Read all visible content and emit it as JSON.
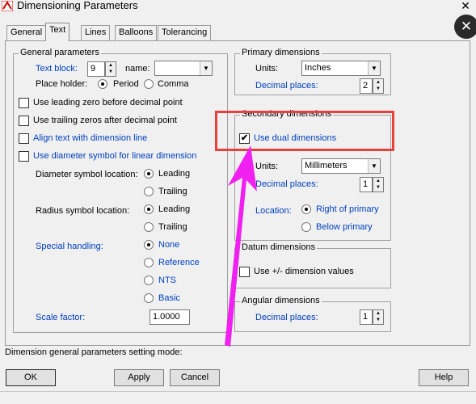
{
  "window": {
    "title": "Dimensioning Parameters",
    "close_glyph": "✕"
  },
  "overlay": {
    "close_glyph": "✕"
  },
  "tabs": [
    {
      "label": "General"
    },
    {
      "label": "Text"
    },
    {
      "label": "Lines"
    },
    {
      "label": "Balloons"
    },
    {
      "label": "Tolerancing"
    }
  ],
  "general_parameters": {
    "title": "General parameters",
    "text_block_label": "Text block:",
    "text_block_value": "9",
    "name_label": "name:",
    "name_value": "",
    "place_holder_label": "Place holder:",
    "place_holder_options": [
      "Period",
      "Comma"
    ],
    "place_holder_selected": "Period",
    "checkboxes": [
      {
        "label": "Use leading zero before decimal point",
        "checked": false
      },
      {
        "label": "Use trailing zeros after decimal point",
        "checked": false
      },
      {
        "label": "Align text with dimension line",
        "checked": false
      },
      {
        "label": "Use diameter symbol for linear dimension",
        "checked": false
      }
    ],
    "diameter_label": "Diameter symbol location:",
    "diameter_options": [
      "Leading",
      "Trailing"
    ],
    "diameter_selected": "Leading",
    "radius_label": "Radius symbol location:",
    "radius_options": [
      "Leading",
      "Trailing"
    ],
    "radius_selected": "Leading",
    "special_label": "Special handling:",
    "special_options": [
      "None",
      "Reference",
      "NTS",
      "Basic"
    ],
    "special_selected": "None",
    "scale_label": "Scale factor:",
    "scale_value": "1.0000"
  },
  "primary": {
    "title": "Primary dimensions",
    "units_label": "Units:",
    "units_value": "Inches",
    "decimal_label": "Decimal places:",
    "decimal_value": "2"
  },
  "secondary": {
    "title": "Secondary dimensions",
    "dual_label": "Use dual dimensions",
    "dual_checked": true,
    "units_label": "Units:",
    "units_value": "Millimeters",
    "decimal_label": "Decimal places:",
    "decimal_value": "1",
    "location_label": "Location:",
    "location_options": [
      "Right of primary",
      "Below primary"
    ],
    "location_selected": "Right of primary"
  },
  "datum": {
    "title": "Datum dimensions",
    "checkbox_label": "Use +/- dimension values",
    "checked": false
  },
  "angular": {
    "title": "Angular dimensions",
    "decimal_label": "Decimal places:",
    "decimal_value": "1"
  },
  "status_text": "Dimension general parameters setting mode:",
  "buttons": {
    "ok": "OK",
    "apply": "Apply",
    "cancel": "Cancel",
    "help": "Help"
  },
  "colors": {
    "accent_blue": "#0040c0",
    "highlight_red": "#e8403a",
    "arrow_magenta": "#f020f0"
  }
}
